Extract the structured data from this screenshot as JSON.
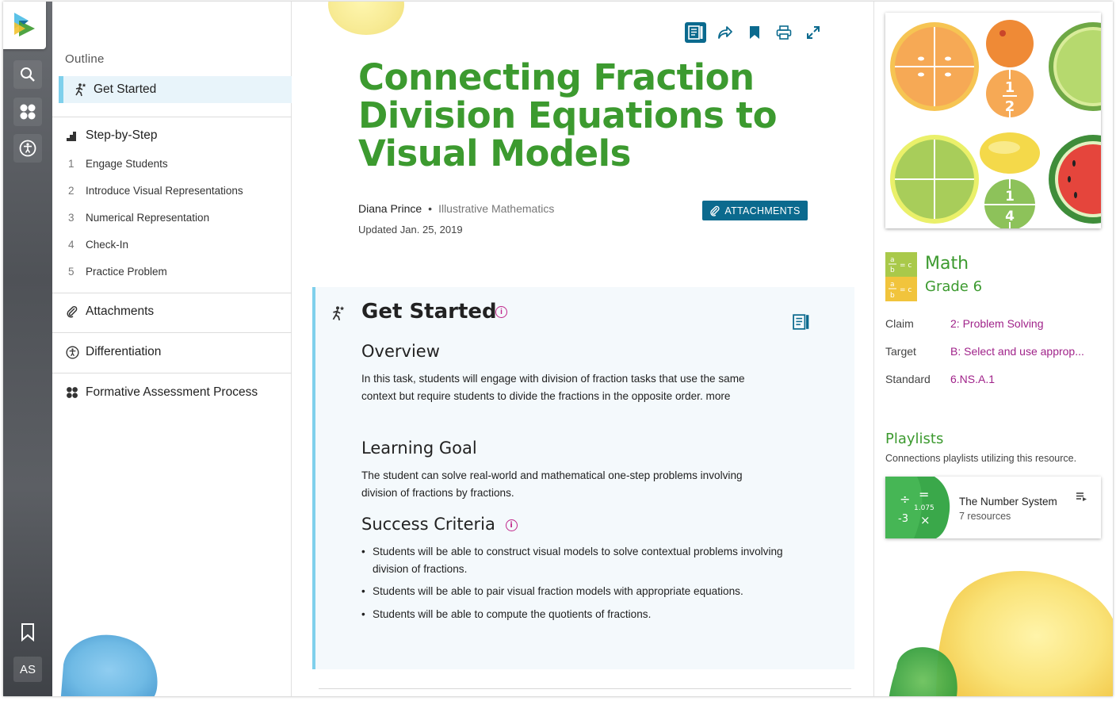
{
  "rail": {
    "avatar_initials": "AS",
    "icons": [
      "search-icon",
      "apps-icon",
      "accessibility-icon",
      "bookmark-icon"
    ]
  },
  "outline": {
    "title": "Outline",
    "active_item": "Get Started",
    "sections": {
      "step_by_step": "Step-by-Step",
      "attachments": "Attachments",
      "differentiation": "Differentiation",
      "formative": "Formative Assessment Process"
    },
    "steps": [
      {
        "num": "1",
        "label": "Engage Students"
      },
      {
        "num": "2",
        "label": "Introduce Visual Representations"
      },
      {
        "num": "3",
        "label": "Numerical Representation"
      },
      {
        "num": "4",
        "label": "Check-In"
      },
      {
        "num": "5",
        "label": "Practice Problem"
      }
    ]
  },
  "main": {
    "title": "Connecting Fraction Division Equations to Visual Models",
    "author": "Diana Prince",
    "organization": "Illustrative Mathematics",
    "updated_label": "Updated",
    "updated_date": "Jan. 25, 2019",
    "attachments_button": "ATTACHMENTS",
    "colors": {
      "title_green": "#3c9a2f",
      "accent_blue": "#0b6a8e",
      "link_magenta": "#a0238a",
      "card_border": "#7fd0ec"
    },
    "card": {
      "heading": "Get Started",
      "overview_heading": "Overview",
      "overview_text": "In this task, students will engage with division of fraction tasks that use the same context but require students to divide the fractions in the opposite order.",
      "overview_more": "more",
      "goal_heading": "Learning Goal",
      "goal_text": "The student can solve real-world and mathematical one-step problems involving division of fractions by fractions.",
      "criteria_heading": "Success Criteria",
      "criteria": [
        "Students will be able to construct visual models to solve contextual problems involving division of fractions.",
        "Students will be able to pair visual fraction models with appropriate equations.",
        "Students will be able to compute the quotients of fractions."
      ]
    }
  },
  "right": {
    "subject": "Math",
    "grade": "Grade 6",
    "meta": {
      "claim_label": "Claim",
      "claim_value": "2: Problem Solving",
      "target_label": "Target",
      "target_value": "B: Select and use approp...",
      "standard_label": "Standard",
      "standard_value": "6.NS.A.1"
    },
    "playlists_title": "Playlists",
    "playlists_subtitle": "Connections playlists utilizing this resource.",
    "playlist": {
      "name": "The Number System",
      "count": "7 resources",
      "thumb_value": "1.075",
      "thumb_neg": "-3"
    },
    "thumb_fractions": {
      "top": "1",
      "top_den": "2",
      "bottom": "1",
      "bottom_den": "4"
    }
  }
}
